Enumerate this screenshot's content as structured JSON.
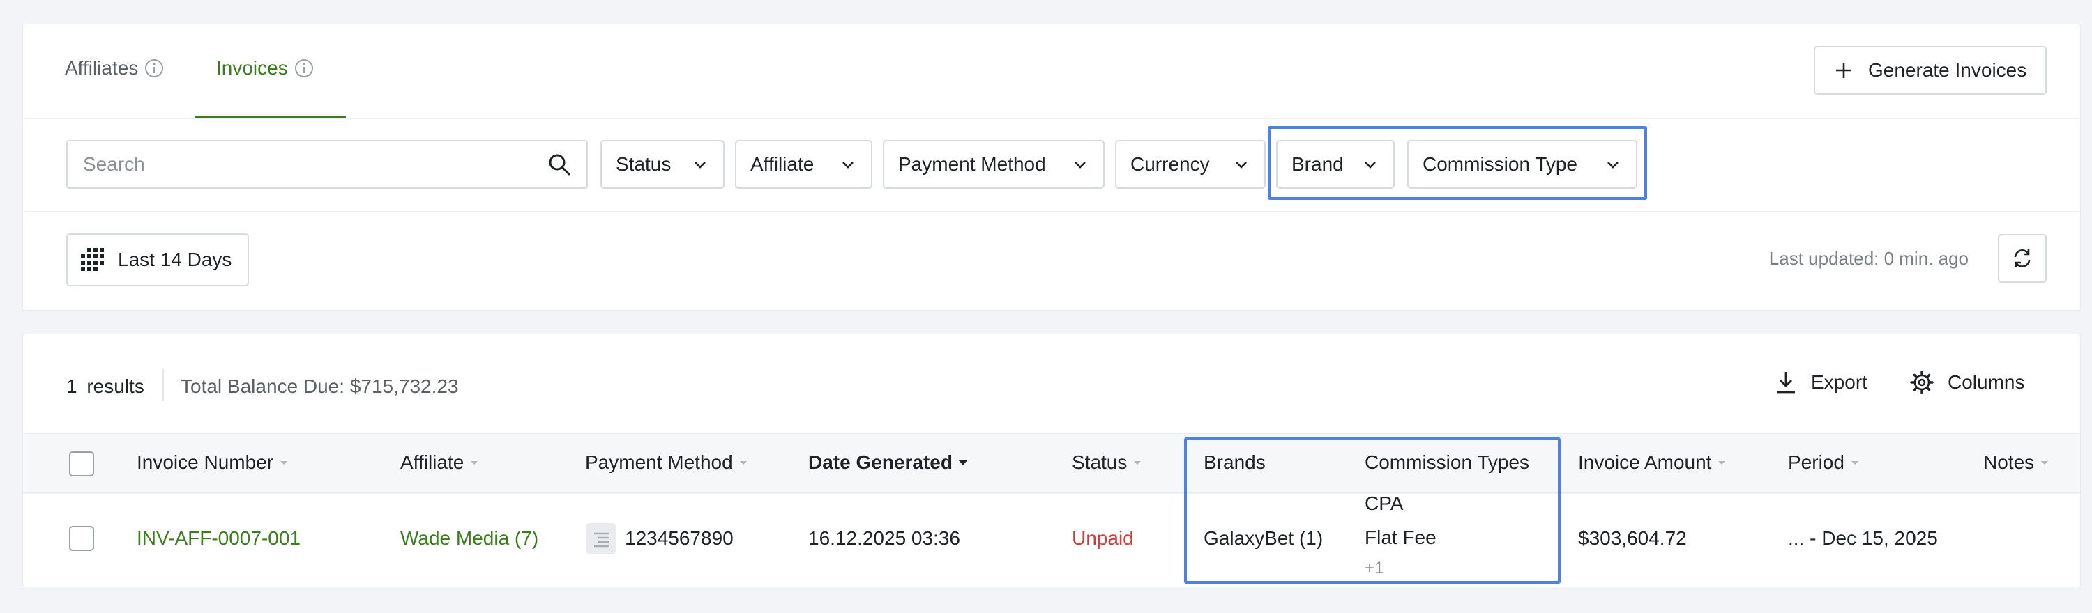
{
  "tabs": [
    {
      "label": "Affiliates"
    },
    {
      "label": "Invoices"
    }
  ],
  "generate_button": {
    "label": "Generate Invoices",
    "icon": "plus-icon"
  },
  "search": {
    "placeholder": "Search",
    "value": ""
  },
  "filters": [
    {
      "label": "Status"
    },
    {
      "label": "Affiliate"
    },
    {
      "label": "Payment Method"
    },
    {
      "label": "Currency"
    },
    {
      "label": "Brand"
    },
    {
      "label": "Commission Type"
    }
  ],
  "date_range": {
    "label": "Last 14 Days",
    "icon": "calendar-grid-icon"
  },
  "last_updated": "Last updated: 0 min. ago",
  "results": {
    "count": "1",
    "label": "results",
    "total_balance": "Total Balance Due: $715,732.23"
  },
  "actions": {
    "export": "Export",
    "columns": "Columns"
  },
  "table": {
    "columns": [
      "Invoice Number",
      "Affiliate",
      "Payment Method",
      "Date Generated",
      "Status",
      "Brands",
      "Commission Types",
      "Invoice Amount",
      "Period",
      "Notes"
    ],
    "sorted_column": "Date Generated",
    "rows": [
      {
        "invoice_number": "INV-AFF-0007-001",
        "affiliate": "Wade Media (7)",
        "payment_method": "1234567890",
        "date_generated": "16.12.2025 03:36",
        "status": "Unpaid",
        "brands": "GalaxyBet (1)",
        "commission_types": [
          "CPA",
          "Flat Fee"
        ],
        "commission_more": "+1",
        "invoice_amount": "$303,604.72",
        "period": "... - Dec 15, 2025",
        "notes": ""
      }
    ]
  },
  "colors": {
    "accent_green": "#3c7d1f",
    "status_unpaid": "#d63c3c",
    "highlight_blue": "#4f82de"
  }
}
